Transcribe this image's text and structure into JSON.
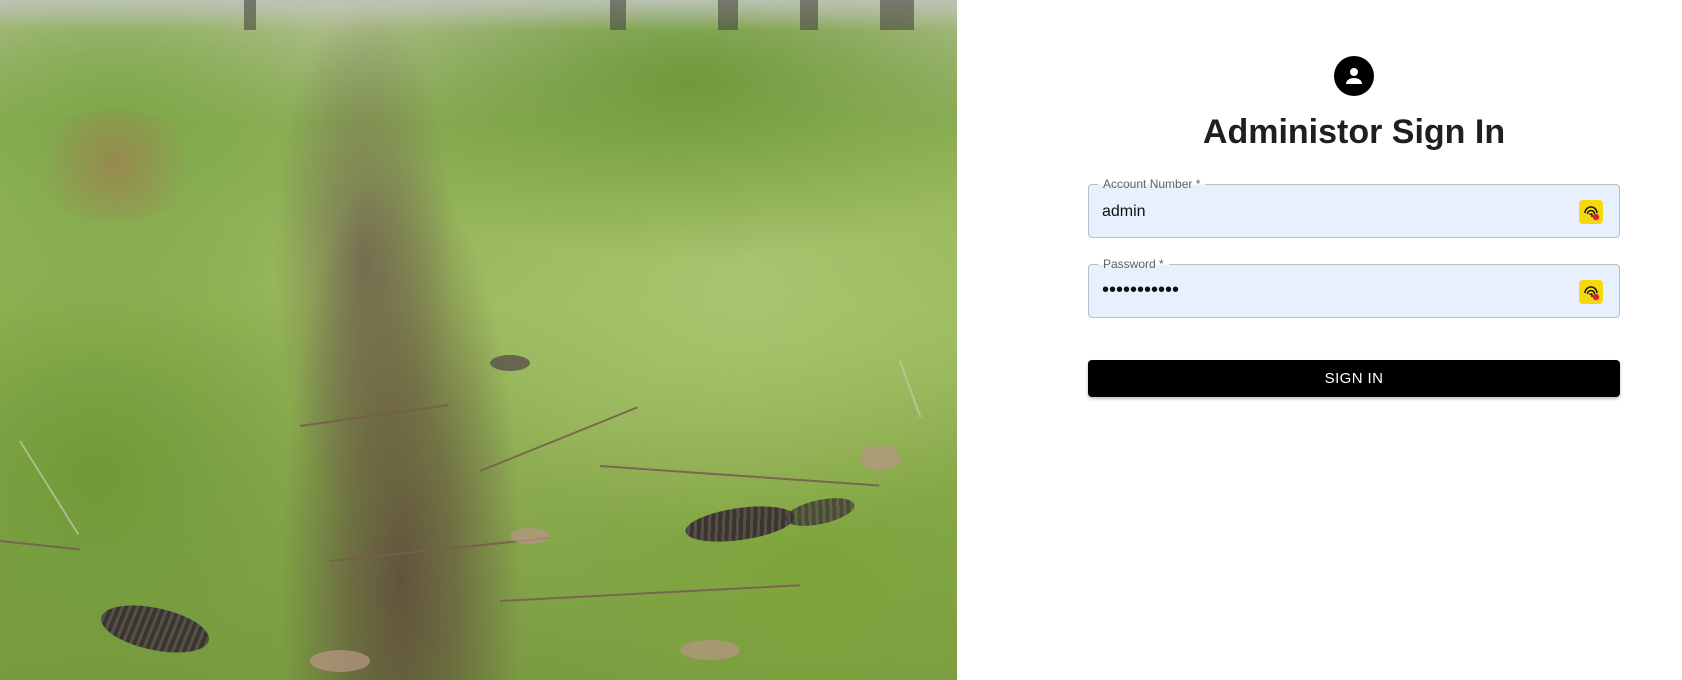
{
  "form": {
    "title": "Administor Sign In",
    "account": {
      "label": "Account Number *",
      "value": "admin"
    },
    "password": {
      "label": "Password *",
      "value": "•••••••••••"
    },
    "submit_label": "SIGN IN"
  },
  "icons": {
    "avatar": "account-circle-icon",
    "autofill": "password-manager-autofill-icon"
  },
  "colors": {
    "primary_button": "#000000",
    "field_background": "#e8f0fe",
    "autofill_badge": "#f5d90a"
  }
}
